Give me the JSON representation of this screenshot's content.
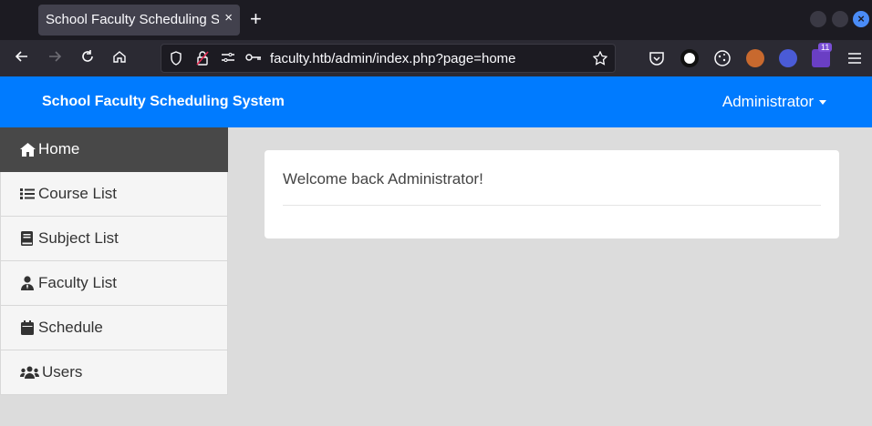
{
  "browser": {
    "tab_title": "School Faculty Scheduling Sy",
    "tab_close": "×",
    "new_tab": "+",
    "url": "faculty.htb/admin/index.php?page=home",
    "extension_badge": "11"
  },
  "header": {
    "title": "School Faculty Scheduling System",
    "user_menu": "Administrator"
  },
  "sidebar": {
    "items": [
      {
        "label": "Home",
        "icon": "home-icon"
      },
      {
        "label": "Course List",
        "icon": "list-icon"
      },
      {
        "label": "Subject List",
        "icon": "book-icon"
      },
      {
        "label": "Faculty List",
        "icon": "user-tie-icon"
      },
      {
        "label": "Schedule",
        "icon": "calendar-icon"
      },
      {
        "label": "Users",
        "icon": "users-icon"
      }
    ]
  },
  "main": {
    "welcome": "Welcome back Administrator!"
  },
  "colors": {
    "accent": "#007bff",
    "active_nav": "#484848"
  }
}
